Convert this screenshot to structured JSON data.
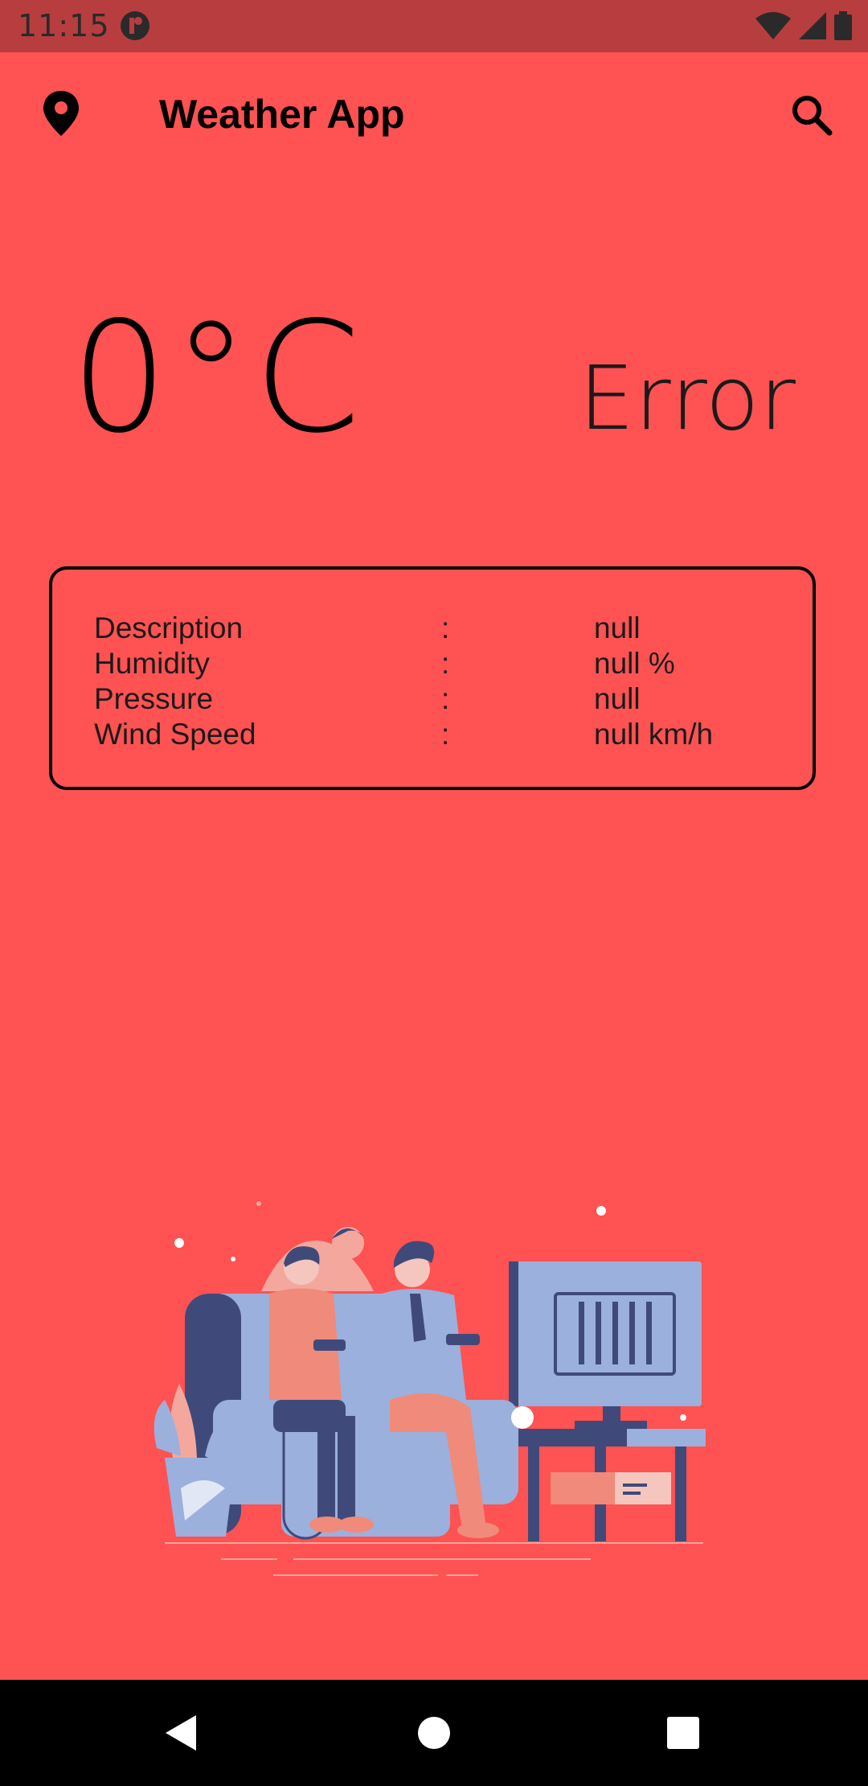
{
  "status_bar": {
    "time": "11:15",
    "icons": [
      "app-notification-icon",
      "wifi-icon",
      "signal-icon",
      "battery-icon"
    ]
  },
  "app_bar": {
    "title": "Weather App",
    "left_icon": "location-pin-icon",
    "right_icon": "search-icon"
  },
  "weather": {
    "temperature": "0°C",
    "location": "Error"
  },
  "details": {
    "rows": [
      {
        "label": "Description",
        "separator": ":",
        "value": "null"
      },
      {
        "label": "Humidity",
        "separator": ":",
        "value": "null %"
      },
      {
        "label": "Pressure",
        "separator": ":",
        "value": "null"
      },
      {
        "label": "Wind Speed",
        "separator": ":",
        "value": "null km/h"
      }
    ]
  },
  "navigation_bar": {
    "buttons": [
      "back-icon",
      "home-icon",
      "recents-icon"
    ]
  },
  "colors": {
    "background": "#FF5252",
    "status_bar": "#B83D3F",
    "illustration_blue": "#9BB0DC",
    "illustration_navy": "#3F4A7A",
    "illustration_salmon": "#F08A7A"
  }
}
